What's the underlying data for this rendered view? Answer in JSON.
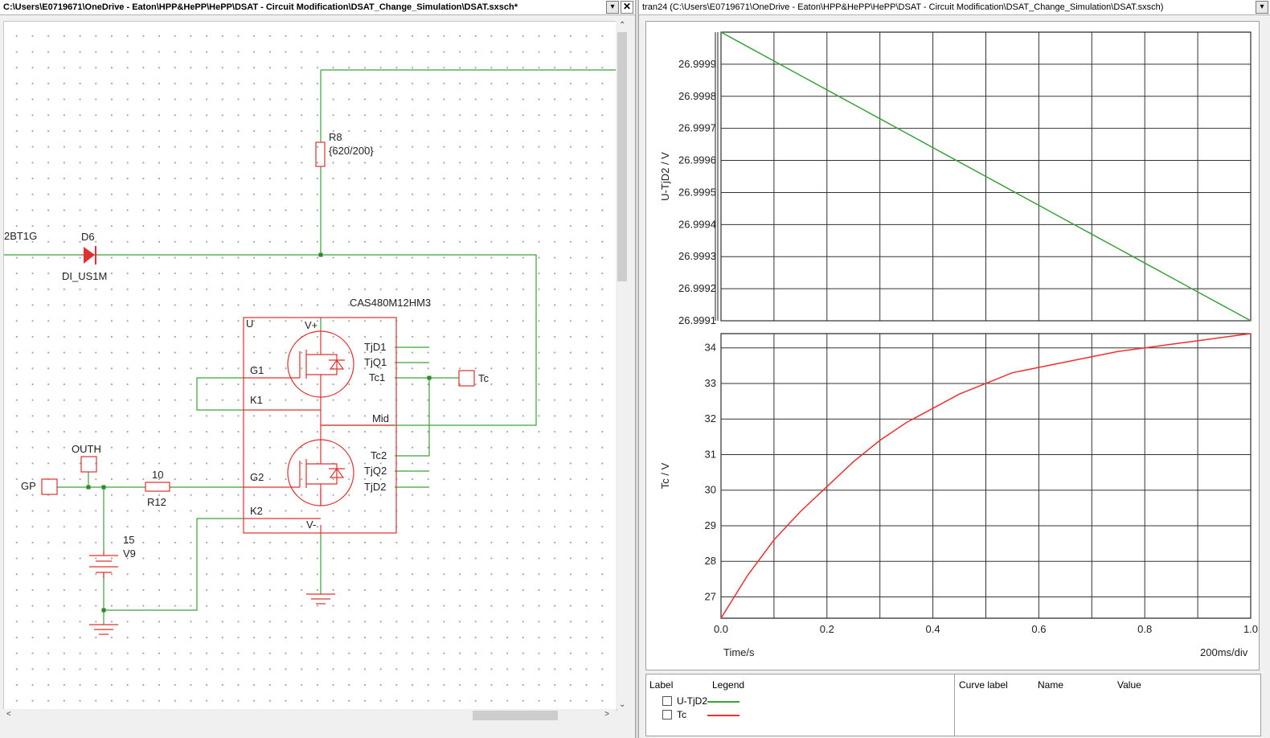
{
  "left_window": {
    "title": "C:\\Users\\E0719671\\OneDrive - Eaton\\HPP&HePP\\HePP\\DSAT - Circuit Modification\\DSAT_Change_Simulation\\DSAT.sxsch*"
  },
  "right_window": {
    "title": "tran24 (C:\\Users\\E0719671\\OneDrive - Eaton\\HPP&HePP\\HePP\\DSAT - Circuit Modification\\DSAT_Change_Simulation\\DSAT.sxsch)"
  },
  "schematic": {
    "net_label_left": "2BT1G",
    "diode_ref": "D6",
    "diode_model": "DI_US1M",
    "r8_ref": "R8",
    "r8_value": "{620/200}",
    "module_part": "CAS480M12HM3",
    "module_ref": "U",
    "pins": {
      "vplus": "V+",
      "vminus": "V-",
      "g1": "G1",
      "k1": "K1",
      "g2": "G2",
      "k2": "K2",
      "mid": "Mid",
      "tjd1": "TjD1",
      "tjq1": "TjQ1",
      "tc1": "Tc1",
      "tc2": "Tc2",
      "tjq2": "TjQ2",
      "tjd2": "TjD2"
    },
    "tc_port": "Tc",
    "outh_port": "OUTH",
    "gp_port": "GP",
    "r12_ref": "R12",
    "r12_value": "10",
    "v9_value": "15",
    "v9_ref": "V9"
  },
  "plot": {
    "x_axis_label": "Time/s",
    "x_div": "200ms/div",
    "colors": {
      "u_tjd2": "#3aa03a",
      "tc": "#ee3030"
    }
  },
  "chart_data": [
    {
      "type": "line",
      "ylabel": "U-TjD2 / V",
      "ylim": [
        26.9991,
        27.0
      ],
      "y_ticks": [
        "26.9999",
        "26.9998",
        "26.9997",
        "26.9996",
        "26.9995",
        "26.9994",
        "26.9993",
        "26.9992",
        "26.9991"
      ],
      "x_ticks": [
        "0.0",
        "0.2",
        "0.4",
        "0.6",
        "0.8",
        "1.0"
      ],
      "xlim": [
        0,
        1.0
      ],
      "grid": true,
      "series": [
        {
          "name": "U-TjD2",
          "x": [
            0.0,
            1.0
          ],
          "y": [
            27.0,
            26.9991
          ]
        }
      ]
    },
    {
      "type": "line",
      "ylabel": "Tc / V",
      "xlabel": "Time/s",
      "ylim": [
        26.4,
        34.4
      ],
      "y_ticks": [
        "34",
        "33",
        "32",
        "31",
        "30",
        "29",
        "28",
        "27"
      ],
      "x_ticks": [
        "0.0",
        "0.2",
        "0.4",
        "0.6",
        "0.8",
        "1.0"
      ],
      "xlim": [
        0,
        1.0
      ],
      "grid": true,
      "series": [
        {
          "name": "Tc",
          "x": [
            0.0,
            0.05,
            0.1,
            0.15,
            0.2,
            0.25,
            0.3,
            0.35,
            0.4,
            0.45,
            0.5,
            0.55,
            0.6,
            0.65,
            0.7,
            0.75,
            0.8,
            0.85,
            0.9,
            0.95,
            1.0
          ],
          "y": [
            26.4,
            27.6,
            28.6,
            29.4,
            30.1,
            30.8,
            31.4,
            31.9,
            32.3,
            32.7,
            33.0,
            33.3,
            33.45,
            33.6,
            33.75,
            33.9,
            34.0,
            34.1,
            34.2,
            34.3,
            34.4
          ]
        }
      ]
    }
  ],
  "legend": {
    "col_label": "Label",
    "col_legend": "Legend",
    "items": [
      "U-TjD2",
      "Tc"
    ]
  },
  "value_table": {
    "col_curve": "Curve label",
    "col_name": "Name",
    "col_value": "Value"
  }
}
